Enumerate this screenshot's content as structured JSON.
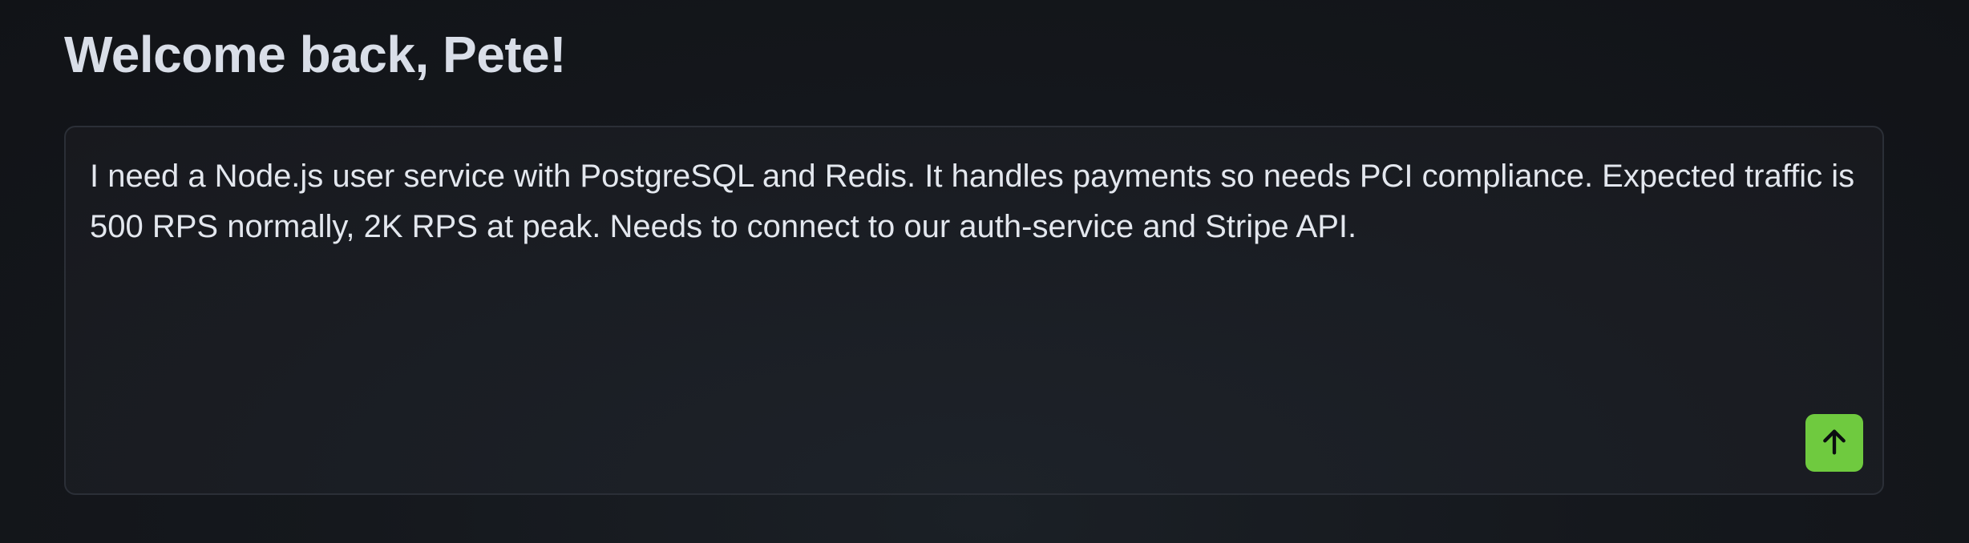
{
  "header": {
    "greeting": "Welcome back, Pete!"
  },
  "composer": {
    "text": "I need a Node.js user service with PostgreSQL and Redis. It handles payments so needs PCI compliance. Expected traffic is 500 RPS normally, 2K RPS at peak. Needs to connect to our auth-service and Stripe API.",
    "send_icon": "arrow-up-icon"
  },
  "colors": {
    "background": "#121418",
    "text": "#e3e7ee",
    "accent": "#6fca3f"
  }
}
